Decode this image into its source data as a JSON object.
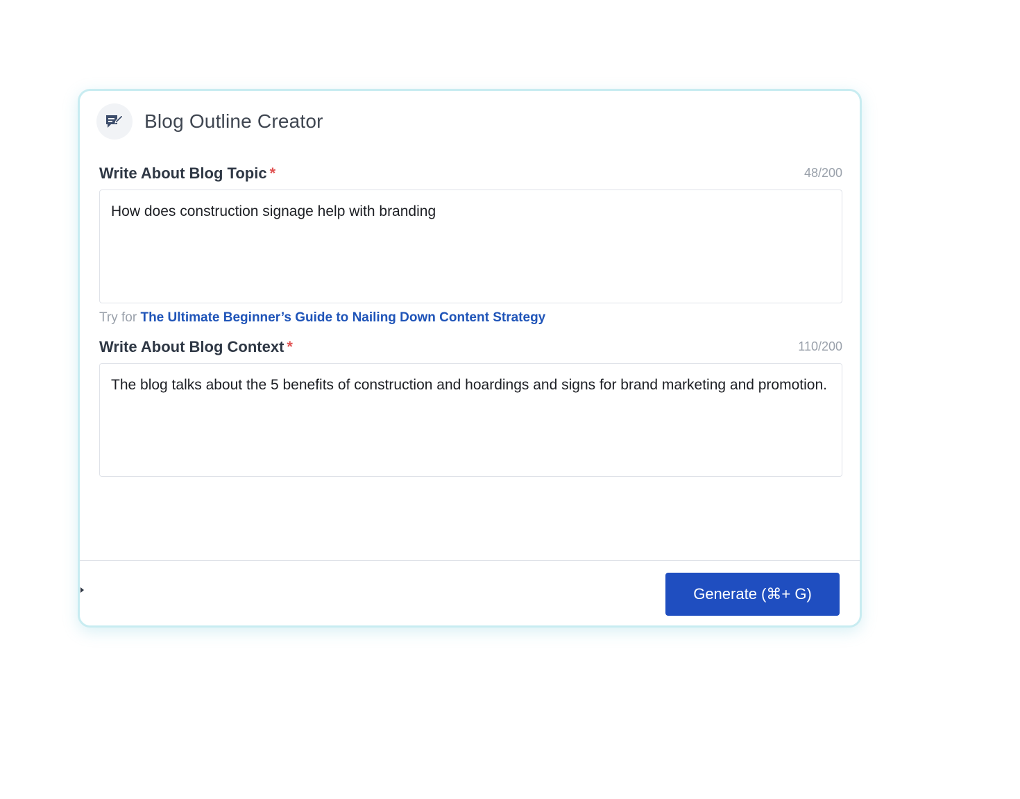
{
  "header": {
    "title": "Blog Outline Creator",
    "icon": "blog-edit-icon"
  },
  "topic": {
    "label": "Write About Blog Topic",
    "required_mark": "*",
    "counter": "48/200",
    "value": "How does construction signage help with branding",
    "hint_prefix": "Try for",
    "hint_link": "The Ultimate Beginner’s Guide to Nailing Down Content Strategy"
  },
  "context": {
    "label": "Write About Blog Context",
    "required_mark": "*",
    "counter": "110/200",
    "value": "The blog talks about the 5 benefits of construction and hoardings and signs for brand marketing and promotion."
  },
  "footer": {
    "generate_label": "Generate (⌘+ G)"
  },
  "colors": {
    "accent": "#1f4ec0",
    "link": "#1f54b8",
    "required": "#e05252",
    "card_border": "#c8ecf1"
  }
}
